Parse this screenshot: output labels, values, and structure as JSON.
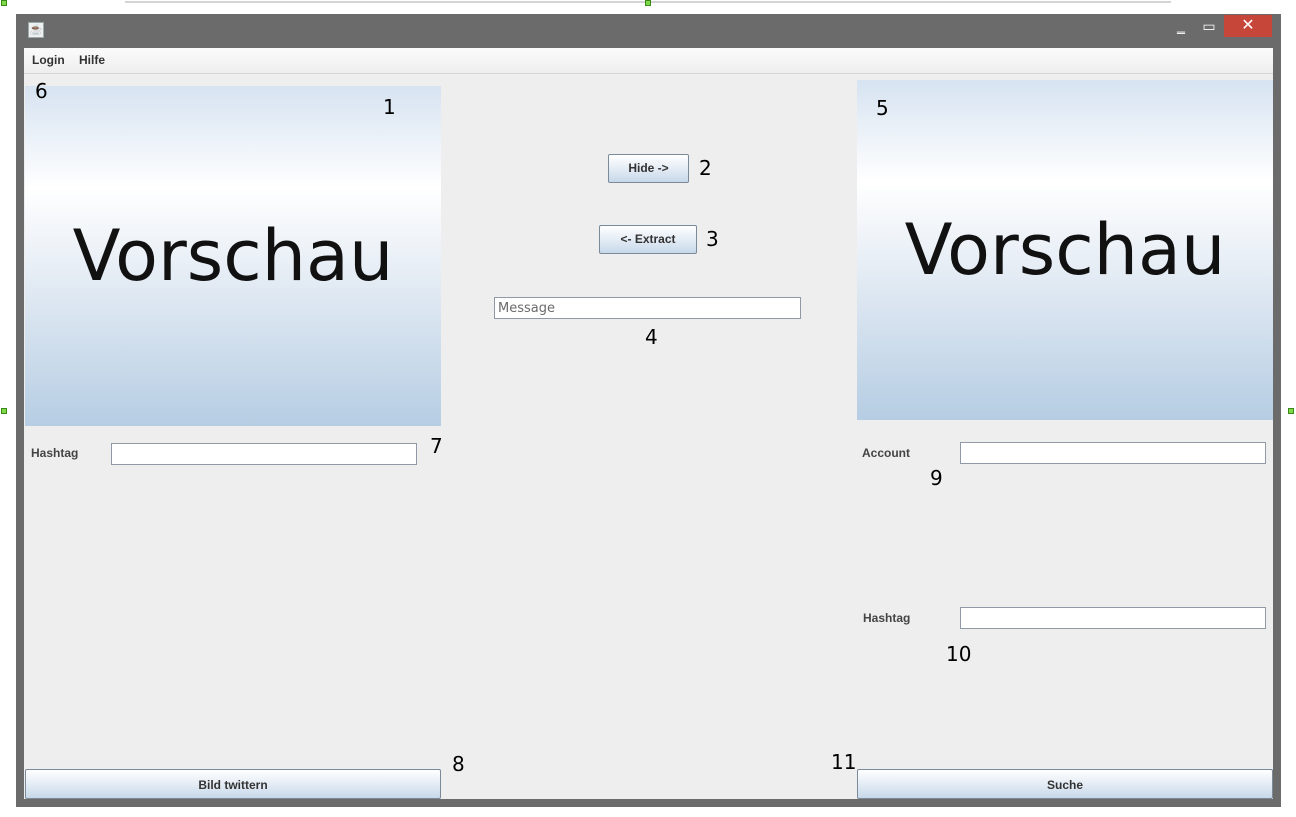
{
  "window": {
    "app_icon": "java-cup-icon",
    "controls": {
      "minimize": "‗",
      "maximize": "▭",
      "close": "✕"
    }
  },
  "menubar": {
    "items": [
      "Login",
      "Hilfe"
    ]
  },
  "left_panel": {
    "preview_text": "Vorschau",
    "hashtag_label": "Hashtag",
    "hashtag_value": "",
    "tweet_button": "Bild twittern"
  },
  "center_panel": {
    "hide_button": "Hide ->",
    "extract_button": "<- Extract",
    "message_placeholder": "Message",
    "message_value": ""
  },
  "right_panel": {
    "preview_text": "Vorschau",
    "account_label": "Account",
    "account_value": "",
    "hashtag_label": "Hashtag",
    "hashtag_value": "",
    "search_button": "Suche"
  },
  "annotations": [
    "1",
    "2",
    "3",
    "4",
    "5",
    "6",
    "7",
    "8",
    "9",
    "10",
    "11"
  ],
  "colors": {
    "close_button": "#c7463a",
    "window_frame": "#6b6b6b",
    "client_bg": "#eeeeee",
    "designer_handle": "#7fd84a"
  }
}
